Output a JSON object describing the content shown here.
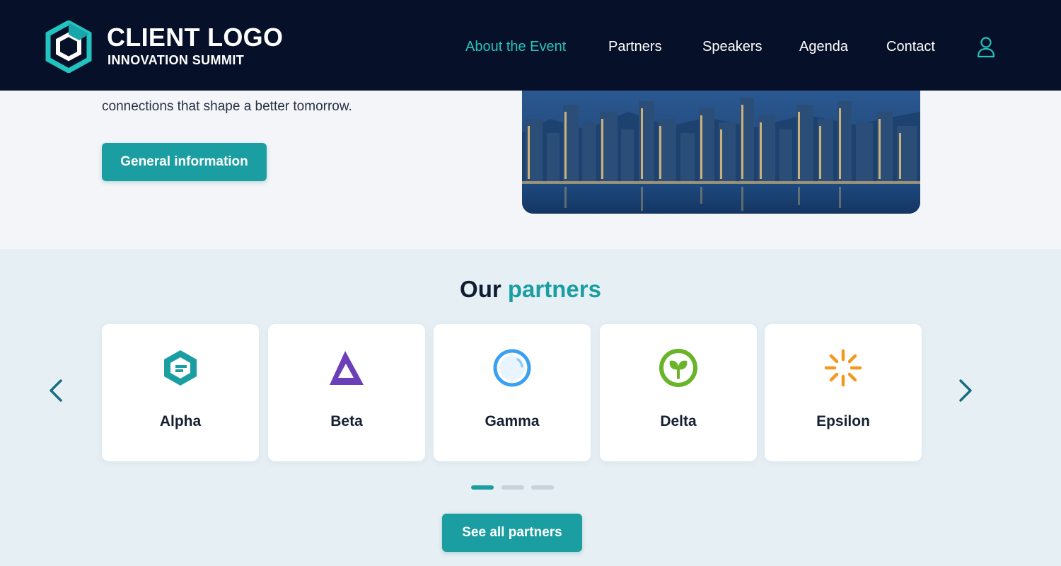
{
  "header": {
    "logo_title": "CLIENT LOGO",
    "logo_subtitle": "INNOVATION SUMMIT",
    "nav": [
      {
        "label": "About the Event",
        "active": true
      },
      {
        "label": "Partners",
        "active": false
      },
      {
        "label": "Speakers",
        "active": false
      },
      {
        "label": "Agenda",
        "active": false
      },
      {
        "label": "Contact",
        "active": false
      }
    ],
    "user_icon": "user-icon"
  },
  "hero": {
    "text": "connections that shape a better tomorrow.",
    "button_label": "General information",
    "image": "city-skyline-image"
  },
  "partners": {
    "title_part1": "Our",
    "title_part2": "partners",
    "cards": [
      {
        "name": "Alpha",
        "icon": "alpha-hexagon-icon",
        "color": "#1a9ea2"
      },
      {
        "name": "Beta",
        "icon": "beta-triangle-icon",
        "color": "#6b3fb8"
      },
      {
        "name": "Gamma",
        "icon": "gamma-circle-icon",
        "color": "#3aa0f0"
      },
      {
        "name": "Delta",
        "icon": "delta-leaf-icon",
        "color": "#6ab42a"
      },
      {
        "name": "Epsilon",
        "icon": "epsilon-sunburst-icon",
        "color": "#f39a1e"
      }
    ],
    "pagination": {
      "pages": 3,
      "active": 1
    },
    "see_all_label": "See all partners"
  },
  "colors": {
    "accent": "#1a9ea2",
    "nav_active": "#25c3bc",
    "header_bg": "#071029"
  }
}
